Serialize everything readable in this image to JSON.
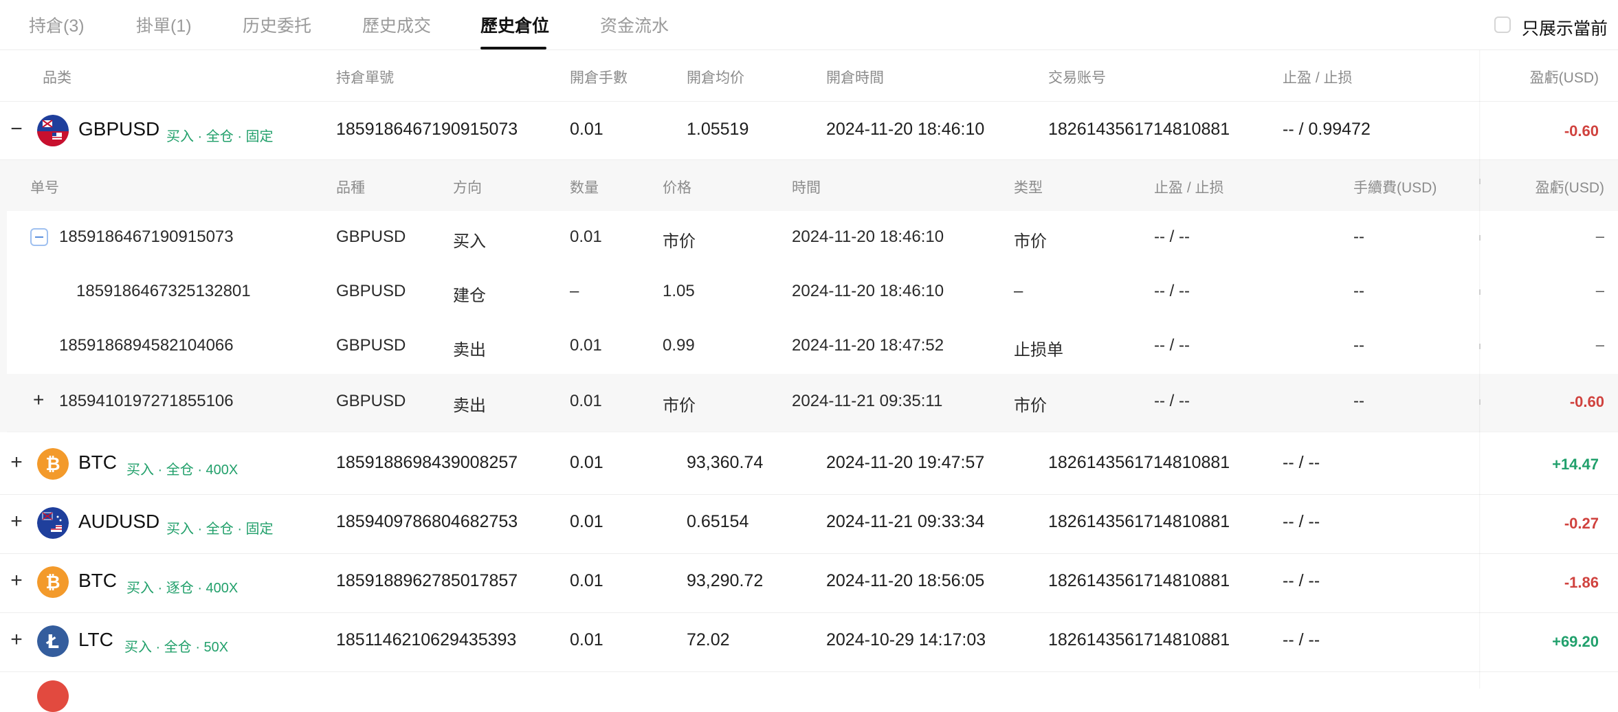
{
  "tabs": [
    {
      "label": "持倉(3)"
    },
    {
      "label": "掛單(1)"
    },
    {
      "label": "历史委托"
    },
    {
      "label": "歷史成交"
    },
    {
      "label": "歷史倉位"
    },
    {
      "label": "资金流水"
    }
  ],
  "current_only_label": "只展示當前",
  "columns": {
    "product": "品类",
    "order_no": "持倉單號",
    "lots": "開倉手數",
    "avg_price": "開倉均价",
    "open_time": "開倉時間",
    "account": "交易账号",
    "tp_sl": "止盈 / 止损",
    "pnl": "盈虧(USD)"
  },
  "sub_columns": {
    "order_no": "单号",
    "product": "品種",
    "direction": "方向",
    "qty": "数量",
    "price": "价格",
    "time": "時間",
    "type": "类型",
    "tp_sl": "止盈 / 止损",
    "fee": "手續費(USD)",
    "pnl": "盈虧(USD)"
  },
  "positions": [
    {
      "toggle": "−",
      "coin": "gbp-us-flag-icon",
      "symbol": "GBPUSD",
      "tags": "买入 · 全仓 · 固定",
      "order_no": "1859186467190915073",
      "lots": "0.01",
      "avg_price": "1.05519",
      "open_time": "2024-11-20 18:46:10",
      "account": "1826143561714810881",
      "tp_sl": "-- / 0.99472",
      "pnl": "-0.60"
    },
    {
      "toggle": "+",
      "coin": "bitcoin-icon",
      "symbol": "BTC",
      "tags": "买入 · 全仓 · 400X",
      "order_no": "1859188698439008257",
      "lots": "0.01",
      "avg_price": "93,360.74",
      "open_time": "2024-11-20 19:47:57",
      "account": "1826143561714810881",
      "tp_sl": "-- / --",
      "pnl": "+14.47"
    },
    {
      "toggle": "+",
      "coin": "aud-us-flag-icon",
      "symbol": "AUDUSD",
      "tags": "买入 · 全仓 · 固定",
      "order_no": "1859409786804682753",
      "lots": "0.01",
      "avg_price": "0.65154",
      "open_time": "2024-11-21 09:33:34",
      "account": "1826143561714810881",
      "tp_sl": "-- / --",
      "pnl": "-0.27"
    },
    {
      "toggle": "+",
      "coin": "bitcoin-icon",
      "symbol": "BTC",
      "tags": "买入 · 逐仓 · 400X",
      "order_no": "1859188962785017857",
      "lots": "0.01",
      "avg_price": "93,290.72",
      "open_time": "2024-11-20 18:56:05",
      "account": "1826143561714810881",
      "tp_sl": "-- / --",
      "pnl": "-1.86"
    },
    {
      "toggle": "+",
      "coin": "litecoin-icon",
      "symbol": "LTC",
      "tags": "买入 · 全仓 · 50X",
      "order_no": "1851146210629435393",
      "lots": "0.01",
      "avg_price": "72.02",
      "open_time": "2024-10-29 14:17:03",
      "account": "1826143561714810881",
      "tp_sl": "-- / --",
      "pnl": "+69.20"
    }
  ],
  "sub_orders": [
    {
      "order_no": "1859186467190915073",
      "product": "GBPUSD",
      "direction": "买入",
      "qty": "0.01",
      "price": "市价",
      "time": "2024-11-20 18:46:10",
      "type": "市价",
      "tp_sl": "-- / --",
      "fee": "--",
      "pnl": "–"
    },
    {
      "order_no": "1859186467325132801",
      "product": "GBPUSD",
      "direction": "建仓",
      "qty": "–",
      "price": "1.05",
      "time": "2024-11-20 18:46:10",
      "type": "–",
      "tp_sl": "-- / --",
      "fee": "--",
      "pnl": "–"
    },
    {
      "order_no": "1859186894582104066",
      "product": "GBPUSD",
      "direction": "卖出",
      "qty": "0.01",
      "price": "0.99",
      "time": "2024-11-20 18:47:52",
      "type": "止损单",
      "tp_sl": "-- / --",
      "fee": "--",
      "pnl": "–"
    },
    {
      "toggle": "+",
      "order_no": "1859410197271855106",
      "product": "GBPUSD",
      "direction": "卖出",
      "qty": "0.01",
      "price": "市价",
      "time": "2024-11-21 09:35:11",
      "type": "市价",
      "tp_sl": "-- / --",
      "fee": "--",
      "pnl": "-0.60"
    }
  ]
}
